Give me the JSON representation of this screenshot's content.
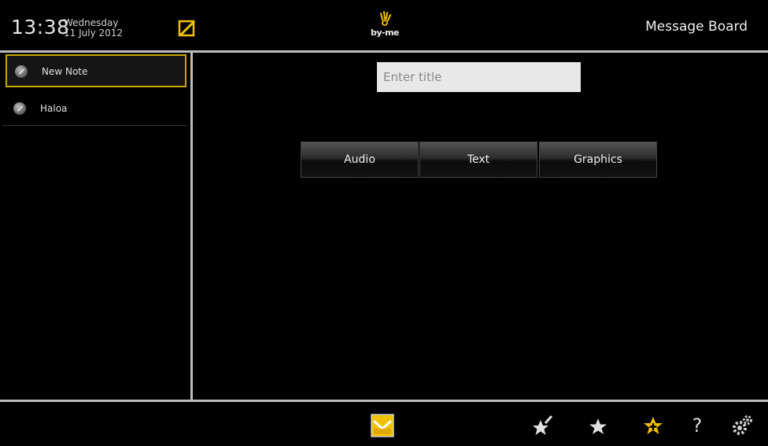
{
  "header": {
    "time": "13:38",
    "weekday": "Wednesday",
    "date": "11 July 2012",
    "logo_text": "by-me",
    "title": "Message Board"
  },
  "sidebar": {
    "items": [
      {
        "label": "New Note",
        "selected": true
      },
      {
        "label": "Haloa",
        "selected": false
      }
    ]
  },
  "main": {
    "title_placeholder": "Enter title",
    "segments": [
      "Audio",
      "Text",
      "Graphics"
    ]
  },
  "icons": {
    "edit": "edit-icon",
    "logo": "hand-logo-icon",
    "message": "message-board-icon",
    "pin": "pin-star-icon",
    "star": "star-icon",
    "add_favorite": "add-favorite-star-icon",
    "help": "help-icon",
    "settings": "settings-gears-icon"
  },
  "colors": {
    "accent": "#f2c200",
    "divider": "#bdbdbd",
    "background": "#000000"
  },
  "footer": {
    "help_label": "?"
  }
}
